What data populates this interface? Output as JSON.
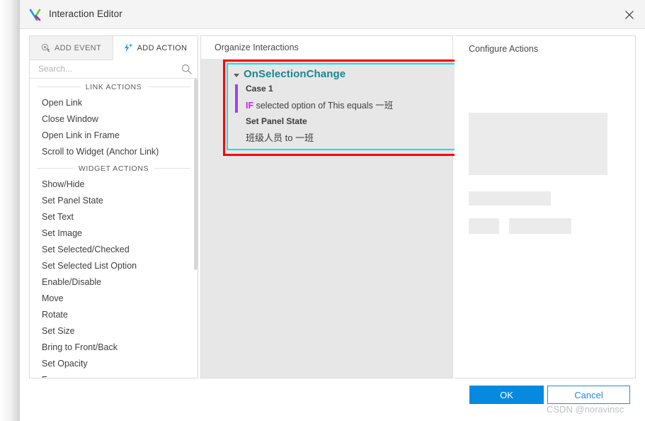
{
  "window": {
    "title": "Interaction Editor",
    "logo_icon": "axure-x-logo-icon",
    "close_icon": "close-icon"
  },
  "left_panel": {
    "tabs": [
      {
        "label": "ADD EVENT",
        "icon": "cursor-click-icon",
        "active": false
      },
      {
        "label": "ADD ACTION",
        "icon": "lightning-plus-icon",
        "active": true
      }
    ],
    "search": {
      "placeholder": "Search...",
      "value": "",
      "icon": "search-icon"
    },
    "groups": [
      {
        "title": "LINK ACTIONS",
        "items": [
          "Open Link",
          "Close Window",
          "Open Link in Frame",
          "Scroll to Widget (Anchor Link)"
        ]
      },
      {
        "title": "WIDGET ACTIONS",
        "items": [
          "Show/Hide",
          "Set Panel State",
          "Set Text",
          "Set Image",
          "Set Selected/Checked",
          "Set Selected List Option",
          "Enable/Disable",
          "Move",
          "Rotate",
          "Set Size",
          "Bring to Front/Back",
          "Set Opacity",
          "Focus"
        ]
      }
    ]
  },
  "mid_panel": {
    "title": "Organize Interactions",
    "event_card": {
      "event_name": "OnSelectionChange",
      "caret_icon": "chevron-down-icon",
      "case_title": "Case 1",
      "condition_keyword": "IF",
      "condition_text": "selected option of This equals 一班",
      "action_title": "Set Panel State",
      "action_detail": "班级人员 to 一班"
    },
    "highlight_color": "#fb0500",
    "selection_color": "#0ce4ec",
    "case_bar_color": "#9b45f0",
    "event_name_color": "#18878f",
    "keyword_color": "#c625e8"
  },
  "right_panel": {
    "title": "Configure Actions"
  },
  "footer": {
    "ok_label": "OK",
    "cancel_label": "Cancel",
    "ok_color": "#068ae0",
    "cancel_color": "#1e8ce0"
  },
  "watermark": {
    "text": "CSDN @noravinsc"
  }
}
